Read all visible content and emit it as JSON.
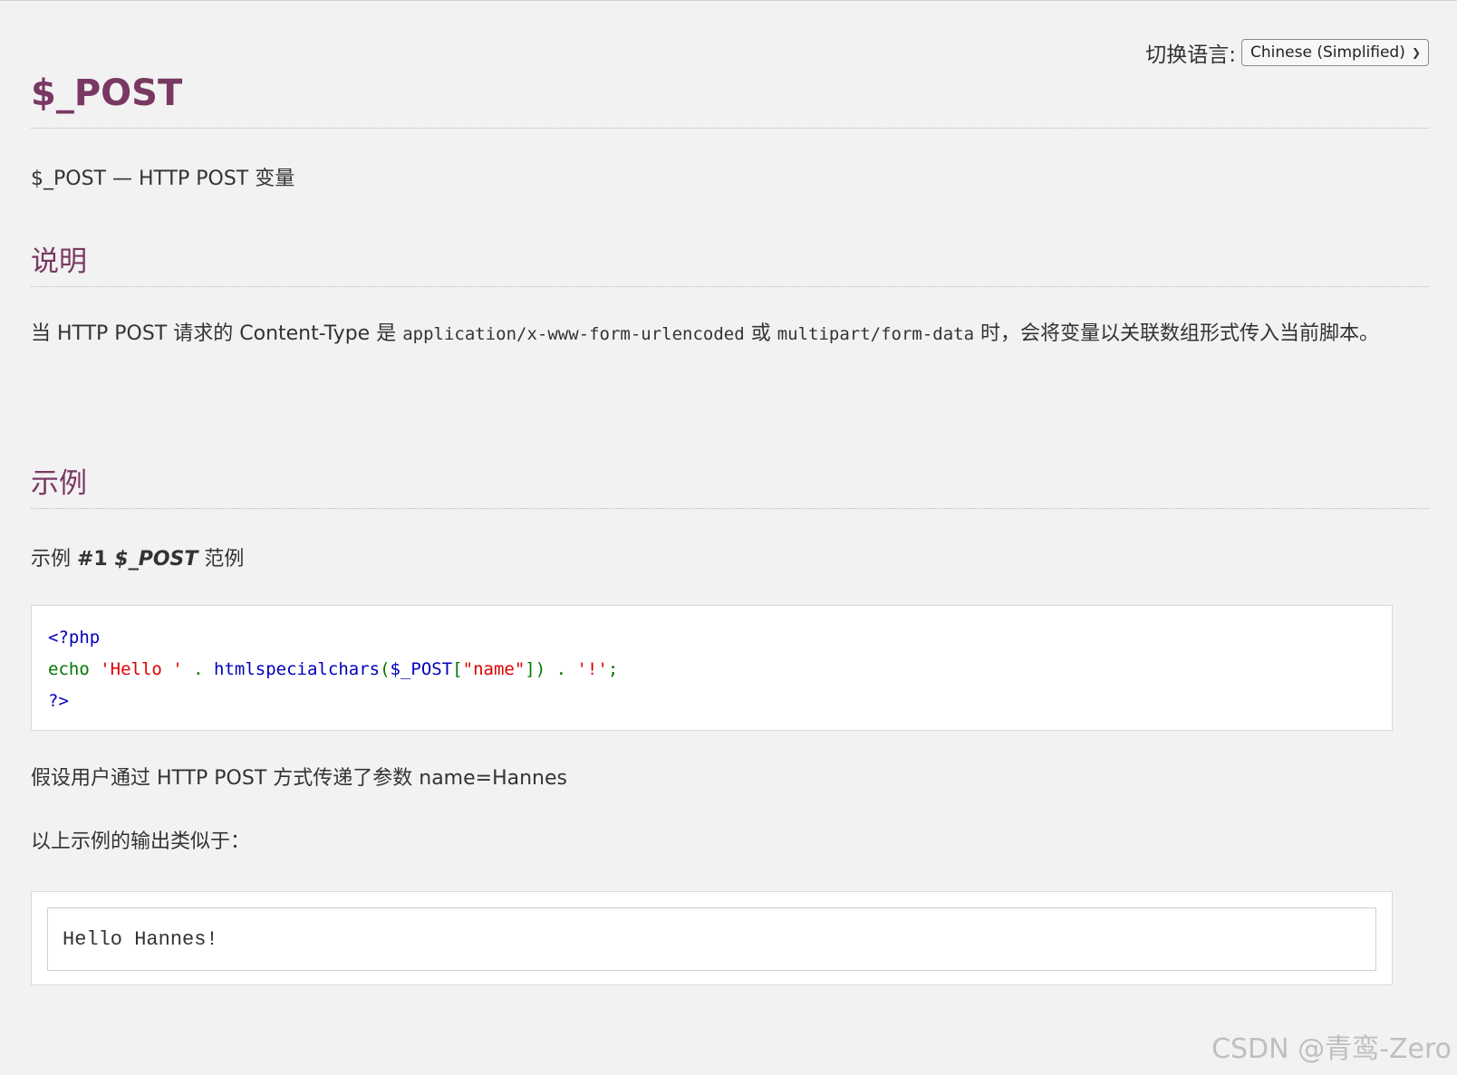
{
  "language_switcher": {
    "label": "切换语言:",
    "selected": "Chinese (Simplified)"
  },
  "title": "$_POST",
  "refpurpose": "$_POST — HTTP POST 变量",
  "sections": {
    "description": {
      "heading": "说明",
      "text_before": "当 HTTP POST 请求的 Content-Type 是 ",
      "code1": "application/x-www-form-urlencoded",
      "text_middle": " 或 ",
      "code2": "multipart/form-data",
      "text_after": " 时，会将变量以关联数组形式传入当前脚本。"
    },
    "examples": {
      "heading": "示例",
      "example_prefix": "示例 ",
      "example_number": "#1",
      "example_var": "$_POST",
      "example_suffix": " 范例",
      "code": {
        "line1": "<?php",
        "echo": "echo ",
        "str_hello": "'Hello '",
        "dot1": " . ",
        "func": "htmlspecialchars",
        "paren_open": "(",
        "var": "$_POST",
        "bracket_open": "[",
        "str_name": "\"name\"",
        "bracket_close": "])",
        "dot2": " . ",
        "str_bang": "'!'",
        "semicolon": ";",
        "line3": "?>"
      },
      "assumption": "假设用户通过 HTTP POST 方式传递了参数 name=Hannes",
      "output_intro": "以上示例的输出类似于：",
      "output": "Hello Hannes!"
    }
  },
  "watermark": "CSDN @青鸾-Zero",
  "colors": {
    "heading": "#793862",
    "php_default": "#0000bb",
    "php_keyword": "#007700",
    "php_string": "#dd0000"
  }
}
